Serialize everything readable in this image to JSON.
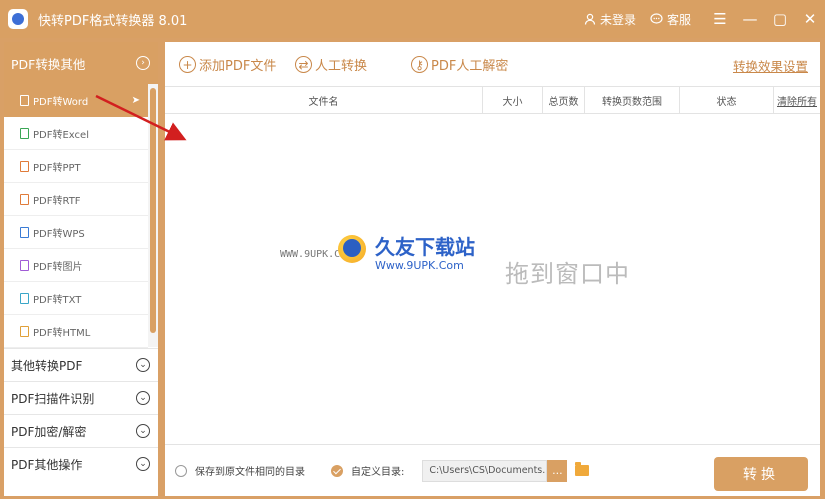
{
  "titlebar": {
    "title": "快转PDF格式转换器 8.01",
    "login": "未登录",
    "service": "客服"
  },
  "sidebar": {
    "header": "PDF转换其他",
    "sub_items": [
      {
        "label": "PDF转Word",
        "active": true,
        "color": "#ffffff"
      },
      {
        "label": "PDF转Excel",
        "color": "#3aa655"
      },
      {
        "label": "PDF转PPT",
        "color": "#e07b39"
      },
      {
        "label": "PDF转RTF",
        "color": "#e07b39"
      },
      {
        "label": "PDF转WPS",
        "color": "#3a7bd5"
      },
      {
        "label": "PDF转图片",
        "color": "#a05cd6"
      },
      {
        "label": "PDF转TXT",
        "color": "#3aa6c8"
      },
      {
        "label": "PDF转HTML",
        "color": "#e0a039"
      }
    ],
    "groups": [
      "其他转换PDF",
      "PDF扫描件识别",
      "PDF加密/解密",
      "PDF其他操作"
    ]
  },
  "toolbar": {
    "add_pdf": "添加PDF文件",
    "manual_convert": "人工转换",
    "manual_decrypt": "PDF人工解密",
    "settings": "转换效果设置"
  },
  "table": {
    "headers": [
      "文件名",
      "大小",
      "总页数",
      "转换页数范围",
      "状态",
      "清除所有"
    ]
  },
  "empty_text": "拖到窗口中",
  "watermark": {
    "left_url": "WWW.9UPK.COM",
    "brand": "久友下载站",
    "url": "Www.9UPK.Com"
  },
  "footer": {
    "save_same_dir": "保存到原文件相同的目录",
    "custom_dir": "自定义目录:",
    "path": "C:\\Users\\CS\\Documents...",
    "browse": "...",
    "convert": "转换"
  },
  "colors": {
    "accent": "#d9a063",
    "accent_text": "#c9884a"
  }
}
